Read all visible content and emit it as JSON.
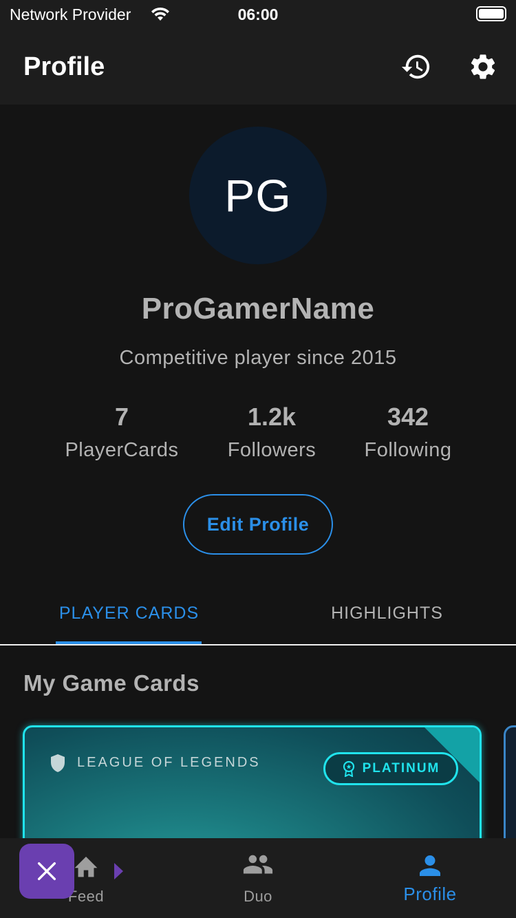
{
  "status_bar": {
    "carrier": "Network Provider",
    "time": "06:00"
  },
  "app_bar": {
    "title": "Profile",
    "history_icon": "history-icon",
    "settings_icon": "gear-icon"
  },
  "profile": {
    "initials": "PG",
    "username": "ProGamerName",
    "bio": "Competitive player since 2015",
    "stats": [
      {
        "value": "7",
        "label": "PlayerCards"
      },
      {
        "value": "1.2k",
        "label": "Followers"
      },
      {
        "value": "342",
        "label": "Following"
      }
    ],
    "edit_button": "Edit Profile"
  },
  "tabs": [
    {
      "label": "PLAYER CARDS",
      "active": true
    },
    {
      "label": "HIGHLIGHTS",
      "active": false
    }
  ],
  "section": {
    "title": "My Game Cards"
  },
  "cards": [
    {
      "game": "LEAGUE OF LEGENDS",
      "rank": "PLATINUM"
    }
  ],
  "bottom_nav": [
    {
      "label": "Feed",
      "icon": "home-icon",
      "active": false
    },
    {
      "label": "Duo",
      "icon": "people-icon",
      "active": false
    },
    {
      "label": "Profile",
      "icon": "person-icon",
      "active": true
    }
  ],
  "colors": {
    "accent": "#2b8fe8",
    "card_glow": "#20e3ec",
    "fab": "#6a3fb0",
    "background": "#141414",
    "surface": "#1d1d1d"
  }
}
